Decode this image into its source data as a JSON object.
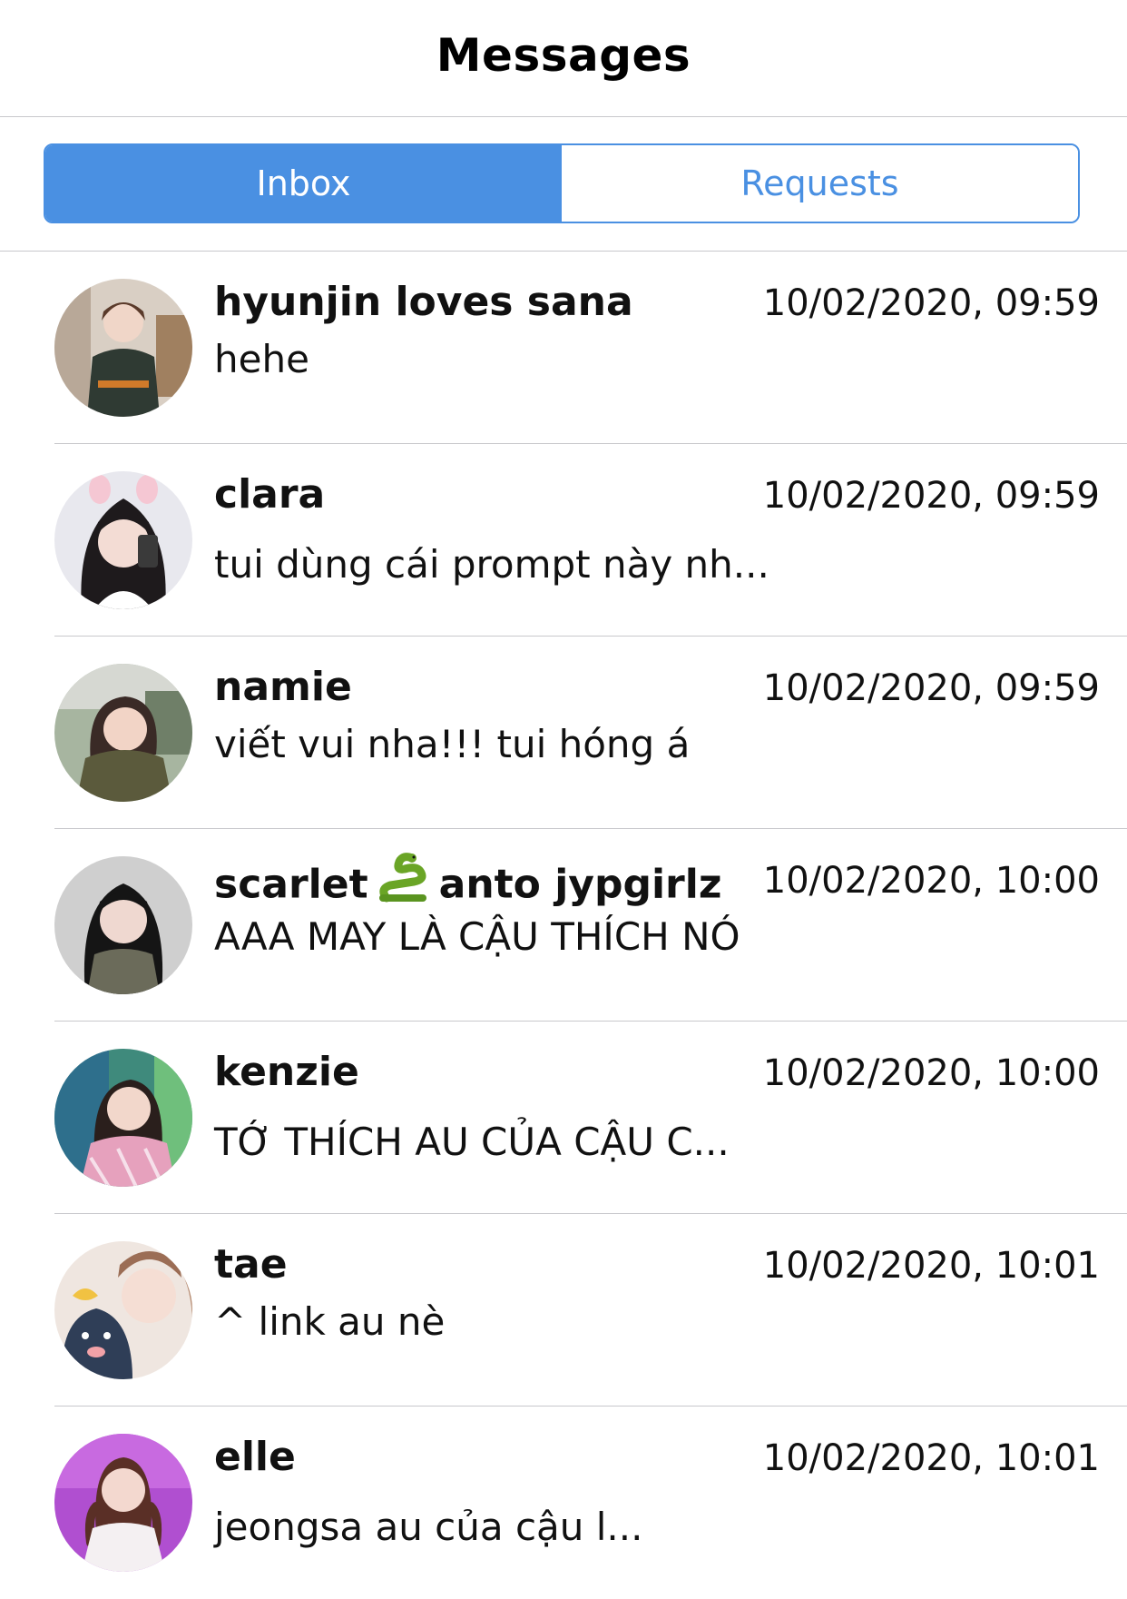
{
  "header": {
    "title": "Messages"
  },
  "tabs": [
    {
      "label": "Inbox",
      "active": true
    },
    {
      "label": "Requests",
      "active": false
    }
  ],
  "colors": {
    "accent": "#4a90e2",
    "divider": "#c8c8cc"
  },
  "conversations": [
    {
      "name": "hyunjin loves sana",
      "time": "10/02/2020, 09:59",
      "preview": "hehe"
    },
    {
      "name": "clara",
      "time": "10/02/2020, 09:59",
      "preview": "tui dùng cái prompt này nh..."
    },
    {
      "name": "namie",
      "time": "10/02/2020, 09:59",
      "preview": "viết vui nha!!! tui hóng á"
    },
    {
      "name_before": "scarlet",
      "name_icon": "snake-emoji-icon",
      "name_after": "anto jypgirlz",
      "time": "10/02/2020, 10:00",
      "preview": "AAA MAY LÀ CẬU THÍCH NÓ"
    },
    {
      "name": "kenzie",
      "time": "10/02/2020, 10:00",
      "preview": "TỚ THÍCH AU CỦA CẬU C..."
    },
    {
      "name": "tae",
      "time": "10/02/2020, 10:01",
      "preview": "^ link au nè"
    },
    {
      "name": "elle",
      "time": "10/02/2020, 10:01",
      "preview": "jeongsa au của cậu l..."
    }
  ]
}
